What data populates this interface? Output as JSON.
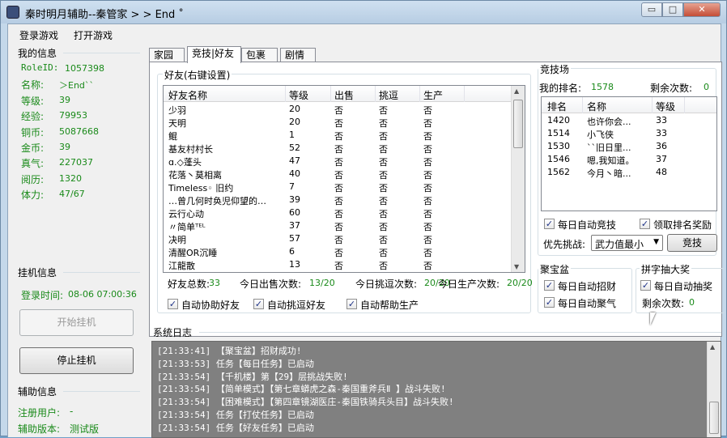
{
  "window": {
    "title": "秦时明月辅助--秦管家 > > End ˚",
    "minimize": "▭",
    "maximize": "□",
    "close": "✕"
  },
  "menu": [
    "登录游戏",
    "打开游戏"
  ],
  "my_info": {
    "header": "我的信息",
    "fields": [
      {
        "label": "RoleID:",
        "value": "1057398"
      },
      {
        "label": "名称:",
        "value": "＞End``"
      },
      {
        "label": "等级:",
        "value": "39"
      },
      {
        "label": "经验:",
        "value": "79953"
      },
      {
        "label": "铜币:",
        "value": "5087668"
      },
      {
        "label": "金币:",
        "value": "39"
      },
      {
        "label": "真气:",
        "value": "227037"
      },
      {
        "label": "阅历:",
        "value": "1320"
      },
      {
        "label": "体力:",
        "value": "47/67"
      }
    ]
  },
  "hang": {
    "header": "挂机信息",
    "login_time_label": "登录时间:",
    "login_time": "08-06 07:00:36",
    "start_button": "开始挂机",
    "stop_button": "停止挂机"
  },
  "assist": {
    "header": "辅助信息",
    "user_label": "注册用户:",
    "user_value": "-",
    "version_label": "辅助版本:",
    "version_value": "测试版"
  },
  "tabs": [
    "家园",
    "竞技|好友",
    "包裹",
    "剧情"
  ],
  "friends": {
    "group_title": "好友(右键设置)",
    "columns": [
      "好友名称",
      "等级",
      "出售",
      "挑逗",
      "生产"
    ],
    "rows": [
      [
        "少羽",
        "20",
        "否",
        "否",
        "否"
      ],
      [
        "天明",
        "20",
        "否",
        "否",
        "否"
      ],
      [
        "鲲",
        "1",
        "否",
        "否",
        "否"
      ],
      [
        "基友村村长",
        "52",
        "否",
        "否",
        "否"
      ],
      [
        "ɑ.◇蓬头",
        "47",
        "否",
        "否",
        "否"
      ],
      [
        "花落丶莫相离",
        "40",
        "否",
        "否",
        "否"
      ],
      [
        "Timeless◦ 旧约",
        "7",
        "否",
        "否",
        "否"
      ],
      [
        "…曾几何时奂児仰望的…",
        "39",
        "否",
        "否",
        "否"
      ],
      [
        "云行心动",
        "60",
        "否",
        "否",
        "否"
      ],
      [
        "〃简单ᵀᴱᴸ",
        "37",
        "否",
        "否",
        "否"
      ],
      [
        "决明",
        "57",
        "否",
        "否",
        "否"
      ],
      [
        "清醒OR沉睡",
        "6",
        "否",
        "否",
        "否"
      ],
      [
        "江龍散",
        "13",
        "否",
        "否",
        "否"
      ]
    ],
    "stats": [
      {
        "label": "好友总数:",
        "value": "33"
      },
      {
        "label": "今日出售次数:",
        "value": "13/20"
      },
      {
        "label": "今日挑逗次数:",
        "value": "20/20"
      },
      {
        "label": "今日生产次数:",
        "value": "20/20"
      }
    ],
    "checks": [
      {
        "label": "自动协助好友",
        "checked": true
      },
      {
        "label": "自动挑逗好友",
        "checked": true
      },
      {
        "label": "自动帮助生产",
        "checked": true
      }
    ]
  },
  "arena": {
    "group_title": "竞技场",
    "rank_label": "我的排名:",
    "rank_value": "1578",
    "remain_label": "剩余次数:",
    "remain_value": "0",
    "columns": [
      "排名",
      "名称",
      "等级"
    ],
    "rows": [
      [
        "1420",
        "也许你会...",
        "33"
      ],
      [
        "1514",
        "小飞侠",
        "33"
      ],
      [
        "1530",
        "``旧日里...",
        "36"
      ],
      [
        "1546",
        "嗯,我知道。",
        "37"
      ],
      [
        "1562",
        "今月丶暗...",
        "48"
      ]
    ],
    "auto_label": "每日自动竞技",
    "auto_checked": true,
    "reward_label": "领取排名奖励",
    "reward_checked": true,
    "priority_label": "优先挑战:",
    "priority_value": "武力值最小",
    "fight_button": "竞技"
  },
  "treasure": {
    "group_title": "聚宝盆",
    "checks": [
      {
        "label": "每日自动招财",
        "checked": true
      },
      {
        "label": "每日自动聚气",
        "checked": true
      }
    ]
  },
  "lottery": {
    "group_title": "拼字抽大奖",
    "check_label": "每日自动抽奖",
    "checked": true,
    "remain_label": "剩余次数:",
    "remain_value": "0"
  },
  "log": {
    "header": "系统日志",
    "lines": [
      "[21:33:41] 【聚宝盆】招财成功!",
      "[21:33:53] 任务【每日任务】已启动",
      "[21:33:54] 【千机楼】第【29】层挑战失败!",
      "[21:33:54] 【简单模式】【第七章蟒虎之森-秦国重斧兵Ⅱ 】战斗失败!",
      "[21:33:54] 【困难模式】【第四章镜湖医庄-秦国铁骑兵头目】战斗失败!",
      "[21:33:54] 任务【打仗任务】已启动",
      "[21:33:54] 任务【好友任务】已启动"
    ]
  }
}
